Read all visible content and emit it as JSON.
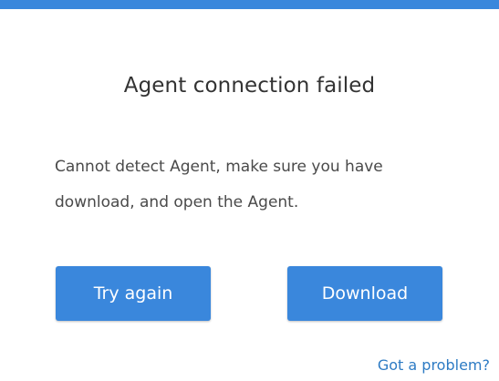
{
  "dialog": {
    "title": "Agent connection failed",
    "message_line1": "Cannot detect Agent, make sure you have",
    "message_line2": "download, and open the Agent.",
    "try_again_label": "Try again",
    "download_label": "Download",
    "problem_link": "Got a problem?"
  },
  "colors": {
    "accent": "#3a87dc",
    "link": "#2d7bc4",
    "title_text": "#333333",
    "body_text": "#4a4a4a"
  }
}
